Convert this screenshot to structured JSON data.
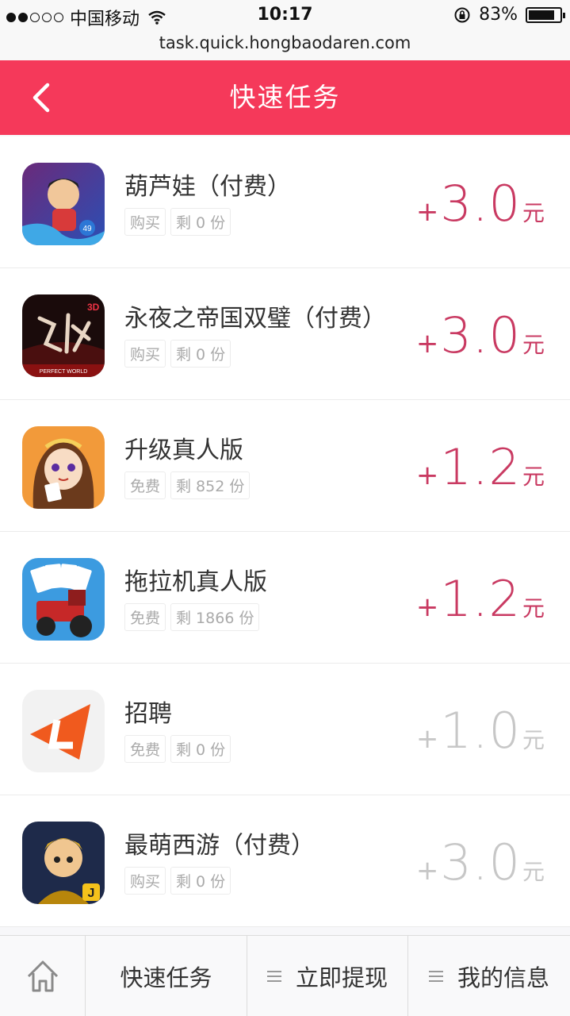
{
  "status_bar": {
    "carrier": "中国移动",
    "time": "10:17",
    "battery": "83%",
    "battery_level": 0.83
  },
  "url": "task.quick.hongbaodaren.com",
  "header": {
    "title": "快速任务",
    "back_icon": "chevron-left-icon"
  },
  "tasks": [
    {
      "name": "葫芦娃（付费）",
      "tag1": "购买",
      "tag2": "剩 0 份",
      "plus": "+",
      "amount": "3.0",
      "unit": "元",
      "dim": false
    },
    {
      "name": "永夜之帝国双璧（付费）",
      "tag1": "购买",
      "tag2": "剩 0 份",
      "plus": "+",
      "amount": "3.0",
      "unit": "元",
      "dim": false
    },
    {
      "name": "升级真人版",
      "tag1": "免费",
      "tag2": "剩 852 份",
      "plus": "+",
      "amount": "1.2",
      "unit": "元",
      "dim": false
    },
    {
      "name": "拖拉机真人版",
      "tag1": "免费",
      "tag2": "剩 1866 份",
      "plus": "+",
      "amount": "1.2",
      "unit": "元",
      "dim": false
    },
    {
      "name": "招聘",
      "tag1": "免费",
      "tag2": "剩 0 份",
      "plus": "+",
      "amount": "1.0",
      "unit": "元",
      "dim": true
    },
    {
      "name": "最萌西游（付费）",
      "tag1": "购买",
      "tag2": "剩 0 份",
      "plus": "+",
      "amount": "3.0",
      "unit": "元",
      "dim": true
    }
  ],
  "bottom_nav": {
    "home_icon": "home-icon",
    "item1": "快速任务",
    "item2": "立即提现",
    "item3": "我的信息"
  },
  "colors": {
    "header": "#f5395a",
    "price": "#c93a62",
    "price_dim": "#c7c7c7"
  }
}
